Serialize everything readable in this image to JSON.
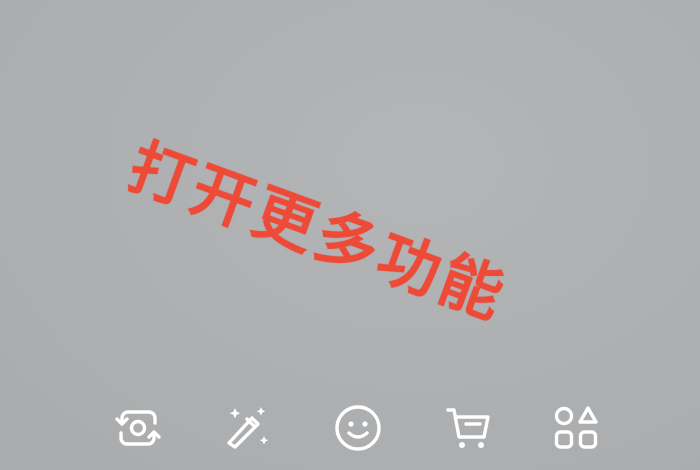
{
  "annotation": {
    "text": "打开更多功能",
    "color": "#ee4a38"
  },
  "toolbar": {
    "icon_color": "#ffffff",
    "items": [
      {
        "icon": "flip-camera-icon"
      },
      {
        "icon": "magic-wand-icon"
      },
      {
        "icon": "smiley-face-icon"
      },
      {
        "icon": "shopping-cart-icon"
      },
      {
        "icon": "more-apps-icon"
      }
    ]
  }
}
